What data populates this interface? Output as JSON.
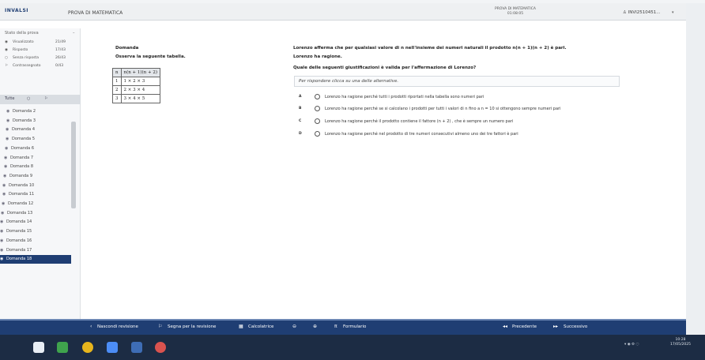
{
  "app": {
    "logo": "INVALSI",
    "title": "PROVA DI MATEMATICA",
    "timer_label": "PROVA DI MATEMATICA",
    "timer_value": "01:08:05",
    "user": "INVI2510451...",
    "user_caret": "▾"
  },
  "sidebar": {
    "header": "Stato della prova",
    "collapse": "–",
    "legend": [
      {
        "icon": "eye-icon",
        "glyph": "◉",
        "label": "Visualizzato",
        "count": "21/49"
      },
      {
        "icon": "answered-icon",
        "glyph": "◉",
        "label": "Risposto",
        "count": "17/43"
      },
      {
        "icon": "empty-circle-icon",
        "glyph": "○",
        "label": "Senza risposta",
        "count": "26/43"
      },
      {
        "icon": "flag-icon",
        "glyph": "⚐",
        "label": "Contrassegnato",
        "count": "0/43"
      }
    ],
    "filters": {
      "all": "Tutte",
      "circle": "○",
      "flag": "⚐"
    },
    "questions": [
      {
        "label": "Domanda 2",
        "indent": 8
      },
      {
        "label": "Domanda 3",
        "indent": 8
      },
      {
        "label": "Domanda 4",
        "indent": 7
      },
      {
        "label": "Domanda 5",
        "indent": 7
      },
      {
        "label": "Domanda 6",
        "indent": 6
      },
      {
        "label": "Domanda 7",
        "indent": 5
      },
      {
        "label": "Domanda 8",
        "indent": 5
      },
      {
        "label": "Domanda 9",
        "indent": 4
      },
      {
        "label": "Domanda 10",
        "indent": 3
      },
      {
        "label": "Domanda 11",
        "indent": 3
      },
      {
        "label": "Domanda 12",
        "indent": 2
      },
      {
        "label": "Domanda 13",
        "indent": 1
      },
      {
        "label": "Domanda 14",
        "indent": 0
      },
      {
        "label": "Domanda 15",
        "indent": 0
      },
      {
        "label": "Domanda 16",
        "indent": 0
      },
      {
        "label": "Domanda 17",
        "indent": 0
      },
      {
        "label": "Domanda 18",
        "indent": 0,
        "active": true
      }
    ]
  },
  "content": {
    "section": "Domanda",
    "intro": "Osserva la seguente tabella.",
    "table": {
      "headers": [
        "n",
        "n(n + 1)(n + 2)"
      ],
      "rows": [
        [
          "1",
          "1 × 2 × 3"
        ],
        [
          "2",
          "2 × 3 × 4"
        ],
        [
          "3",
          "3 × 4 × 5"
        ]
      ]
    },
    "statement": "Lorenzo afferma che per qualsiasi valore di n nell'insieme dei numeri naturali il prodotto n(n + 1)(n + 2) è pari.",
    "statement2": "Lorenzo ha ragione.",
    "question": "Quale delle seguenti giustificazioni è valida per l'affermazione di Lorenzo?",
    "hint": "Per rispondere clicca su una delle alternative.",
    "options": [
      {
        "letter": "A",
        "text": "Lorenzo ha ragione perché tutti i prodotti riportati nella tabella sono numeri pari"
      },
      {
        "letter": "B",
        "text": "Lorenzo ha ragione perché se si calcolano i prodotti per tutti i valori di n fino a n = 10 si ottengono sempre numeri pari"
      },
      {
        "letter": "C",
        "text": "Lorenzo ha ragione perché il prodotto contiene il fattore (n + 2) , che è sempre un numero pari"
      },
      {
        "letter": "D",
        "text": "Lorenzo ha ragione perché nel prodotto di tre numeri consecutivi almeno uno dei tre fattori è pari"
      }
    ]
  },
  "bottombar": {
    "hide_review": "Nascondi revisione",
    "flag_review": "Segna per la revisione",
    "calculator": "Calcolatrice",
    "formulary": "Formulario",
    "previous": "Precedente",
    "next": "Successivo"
  },
  "taskbar": {
    "clock_time": "10:28",
    "clock_date": "17/05/2025"
  },
  "colors": {
    "accent": "#1f3e73",
    "taskbar": "#1c2c44"
  }
}
